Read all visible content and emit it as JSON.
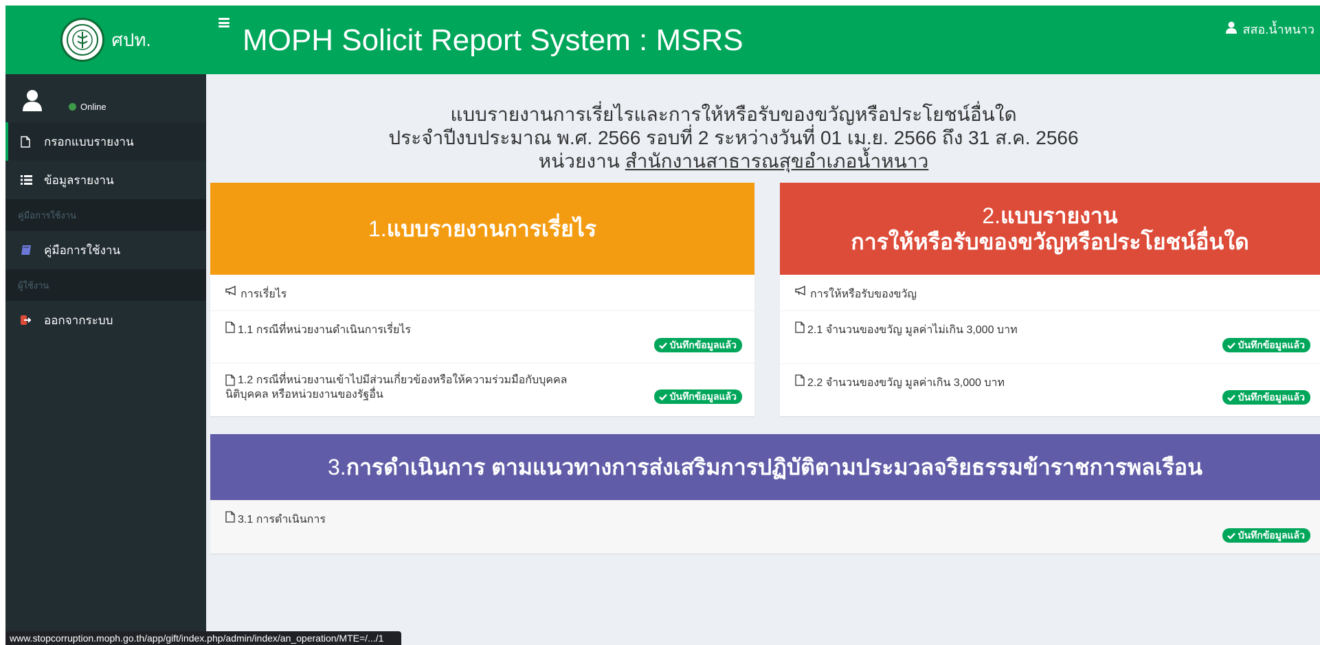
{
  "header": {
    "logo_text": "ศปท.",
    "app_title": "MOPH Solicit Report System : MSRS",
    "user_name": "สสอ.น้ำหนาว"
  },
  "sidebar": {
    "status": "Online",
    "items": [
      {
        "label": "กรอกแบบรายงาน",
        "icon": "file-icon"
      },
      {
        "label": "ข้อมูลรายงาน",
        "icon": "list-icon"
      }
    ],
    "header_manual": "คู่มือการใช้งาน",
    "manual_item": {
      "label": "คู่มือการใช้งาน",
      "icon": "book-icon"
    },
    "header_user": "ผู้ใช้งาน",
    "logout_item": {
      "label": "ออกจากระบบ",
      "icon": "sign-out-icon"
    }
  },
  "heading": {
    "line1": "แบบรายงานการเรี่ยไรและการให้หรือรับของขวัญหรือประโยชน์อื่นใด",
    "line2": "ประจำปีงบประมาณ พ.ศ. 2566 รอบที่ 2 ระหว่างวันที่ 01 เม.ย. 2566 ถึง 31 ส.ค. 2566",
    "line3_prefix": "หน่วยงาน",
    "agency": "สำนักงานสาธารณสุขอำเภอน้ำหนาว"
  },
  "boxes": {
    "b1": {
      "num": "1.",
      "title": "แบบรายงานการเรี่ยไร",
      "section_label": "การเรี่ยไร",
      "rows": [
        {
          "label": "1.1 กรณีที่หน่วยงานดำเนินการเรี่ยไร",
          "status": "บันทึกข้อมูลแล้ว"
        },
        {
          "label1": "1.2 กรณีที่หน่วยงานเข้าไปมีส่วนเกี่ยวข้องหรือให้ความร่วมมือกับบุคคล",
          "label2": "นิติบุคคล หรือหน่วยงานของรัฐอื่น",
          "status": "บันทึกข้อมูลแล้ว"
        }
      ]
    },
    "b2": {
      "num": "2.",
      "title_line1": "แบบรายงาน",
      "title_line2": "การให้หรือรับของขวัญหรือประโยชน์อื่นใด",
      "section_label": "การให้หรือรับของขวัญ",
      "rows": [
        {
          "label": "2.1 จำนวนของขวัญ มูลค่าไม่เกิน 3,000 บาท",
          "status": "บันทึกข้อมูลแล้ว"
        },
        {
          "label": "2.2 จำนวนของขวัญ มูลค่าเกิน 3,000 บาท",
          "status": "บันทึกข้อมูลแล้ว"
        }
      ]
    },
    "b3": {
      "num": "3.",
      "title": "การดำเนินการ ตามแนวทางการส่งเสริมการปฏิบัติตามประมวลจริยธรรมข้าราชการพลเรือน",
      "rows": [
        {
          "label": "3.1 การดำเนินการ",
          "status": "บันทึกข้อมูลแล้ว"
        }
      ]
    }
  },
  "status_url": "www.stopcorruption.moph.go.th/app/gift/index.php/admin/index/an_operation/MTE=/.../1",
  "colors": {
    "brand_green": "#00a65a",
    "sidebar_bg": "#222d32",
    "box1_orange": "#f39c12",
    "box2_red": "#dd4b39",
    "box3_purple": "#605ca8"
  }
}
